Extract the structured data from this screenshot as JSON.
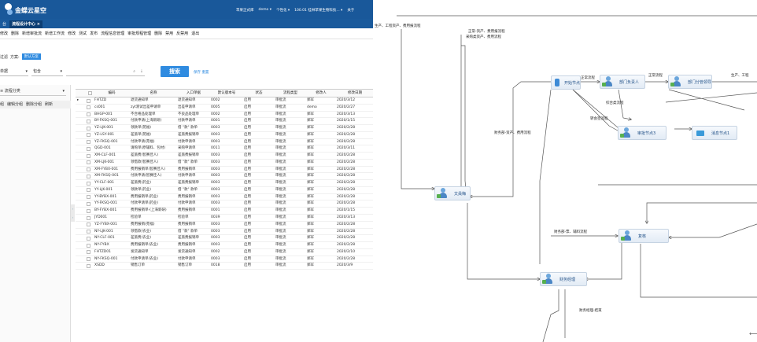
{
  "header": {
    "brand": "金蝶云星空",
    "right": [
      "苹果正式库",
      "demo ▾",
      "个性化 ▾",
      "100.01 桂林苹果生物科技... ▾",
      "关于"
    ]
  },
  "tabs": [
    "台",
    "流程设计中心 ×"
  ],
  "menu": [
    "修改",
    "删除",
    "新增审批流",
    "新增工作流",
    "修改",
    "测试",
    "发布",
    "流程信息管理",
    "审批规程管理",
    "删除",
    "禁用",
    "反禁用",
    "退出"
  ],
  "filter": {
    "label": "过滤",
    "scheme_label": "方案:",
    "scheme_value": "默认方案"
  },
  "search": {
    "field": "单据",
    "op": "包含",
    "placeholder": "",
    "button": "搜索",
    "save": "保存",
    "reset": "重置"
  },
  "sidebar": {
    "tree_label": "流程分类",
    "buttons": [
      "组",
      "编辑分组",
      "删除分组",
      "刷新"
    ]
  },
  "table": {
    "headers": [
      "",
      "",
      "编码",
      "名称",
      "入口单据",
      "默认版本号",
      "状态",
      "流程类型",
      "修改人",
      "修改日期"
    ],
    "rows": [
      [
        "FHTZD",
        "退货通知单",
        "退货通知单",
        "0002",
        "启用",
        "审批流",
        "郑军",
        "2020/3/12"
      ],
      [
        "cs001",
        "zyt测试出差申请单",
        "出差申请单",
        "0005",
        "启用",
        "审批流",
        "demo",
        "2020/2/27"
      ],
      [
        "BHGP-001",
        "不合格品处理单",
        "不良品处理单",
        "0002",
        "启用",
        "审批流",
        "郑军",
        "2020/3/13"
      ],
      [
        "BY-FKSQ-001",
        "付款申请(上海新研)",
        "付款申请单",
        "0001",
        "启用",
        "审批流",
        "郑军",
        "2020/1/15"
      ],
      [
        "YZ-LJK-001",
        "领款单(苑福)",
        "借 \"款\" 款单",
        "0003",
        "启用",
        "审批流",
        "郑军",
        "2020/2/28"
      ],
      [
        "YZ-LSY-001",
        "差旅单(苑福)",
        "差旅费报销单",
        "0003",
        "启用",
        "审批流",
        "郑军",
        "2020/2/28"
      ],
      [
        "YZ-FKSQ-001",
        "付款申请(苑福)",
        "付款申请单",
        "0003",
        "启用",
        "审批流",
        "郑军",
        "2020/2/28"
      ],
      [
        "QGD-001",
        "请购单(原辅料、包材)",
        "采购申请单",
        "0011",
        "启用",
        "审批流",
        "郑军",
        "2020/3/11"
      ],
      [
        "XM-CLF-001",
        "差旅费(智赛佳人)",
        "差旅费报销单",
        "0003",
        "启用",
        "审批流",
        "郑军",
        "2020/2/28"
      ],
      [
        "XM-LJK-001",
        "领借款(智赛佳人)",
        "借 \"款\" 款单",
        "0003",
        "启用",
        "审批流",
        "郑军",
        "2020/2/28"
      ],
      [
        "XM-FYBX-001",
        "费用报销单(智赛佳人)",
        "费用报销单",
        "0003",
        "启用",
        "审批流",
        "郑军",
        "2020/2/28"
      ],
      [
        "XM-FKSQ-001",
        "付款申请(智赛佳人)",
        "付款申请单",
        "0003",
        "启用",
        "审批流",
        "郑军",
        "2020/2/28"
      ],
      [
        "YY-CLF-001",
        "差旅费(药业)",
        "差旅费报销单",
        "0003",
        "启用",
        "审批流",
        "郑军",
        "2020/2/28"
      ],
      [
        "YY-LJK-001",
        "领款单(药业)",
        "借 \"款\" 款单",
        "0003",
        "启用",
        "审批流",
        "郑军",
        "2020/2/28"
      ],
      [
        "YY-BYBX-001",
        "费用报销单(药业)",
        "费用报销单",
        "0003",
        "启用",
        "审批流",
        "郑军",
        "2020/2/28"
      ],
      [
        "YY-FKSQ-001",
        "付款申请单(药业)",
        "付款申请单",
        "0003",
        "启用",
        "审批流",
        "郑军",
        "2020/2/28"
      ],
      [
        "BY-FYBX-001",
        "费用报销单-(上海新研)",
        "费用报销单",
        "0001",
        "启用",
        "审批流",
        "郑军",
        "2020/1/15"
      ],
      [
        "JYD001",
        "检验单",
        "检验单",
        "0039",
        "启用",
        "审批流",
        "郑军",
        "2020/3/13"
      ],
      [
        "YZ-FYBX-001",
        "费用报销(苑福)",
        "费用报销单",
        "0003",
        "启用",
        "审批流",
        "郑军",
        "2020/2/28"
      ],
      [
        "NY-LJK-001",
        "领借款(农业)",
        "借 \"款\" 款单",
        "0003",
        "启用",
        "审批流",
        "郑军",
        "2020/2/28"
      ],
      [
        "NY-CLF-001",
        "差旅费(农业)",
        "差旅费报销单",
        "0003",
        "启用",
        "审批流",
        "郑军",
        "2020/2/28"
      ],
      [
        "NY-FYBX",
        "费用报销单(农业)",
        "费用报销单",
        "0003",
        "启用",
        "审批流",
        "郑军",
        "2020/2/28"
      ],
      [
        "FHTZD01",
        "发货通知单",
        "发货通知单",
        "0002",
        "启用",
        "审批流",
        "郑军",
        "2020/2/10"
      ],
      [
        "NY-FKSQ-001",
        "付款申请单(农业)",
        "付款申请单",
        "0003",
        "启用",
        "审批流",
        "郑军",
        "2020/2/28"
      ],
      [
        "XSDD",
        "销售订单",
        "销售订单",
        "0018",
        "启用",
        "审批流",
        "郑军",
        "2020/3/9"
      ]
    ]
  },
  "flow": {
    "nodes": {
      "start": "开始节点",
      "dept_head": "部门负责人",
      "dept_manager": "部门分管领导",
      "approve3": "审批节点3",
      "notify": "消息节点1",
      "cashier": "文員梅",
      "review": "复核",
      "finance_mgr": "财务经理"
    },
    "edge_labels": [
      "生产、工程资产、费用报流程",
      "正常-资产、费用报流程",
      "采购类资产、费用流程",
      "正常流程",
      "正常流程",
      "生产、工程",
      "综合类流程",
      "转会签流程",
      "财务部-资产、费用流程",
      "财务部-票、辅料流程",
      "财务经理-结束"
    ]
  }
}
